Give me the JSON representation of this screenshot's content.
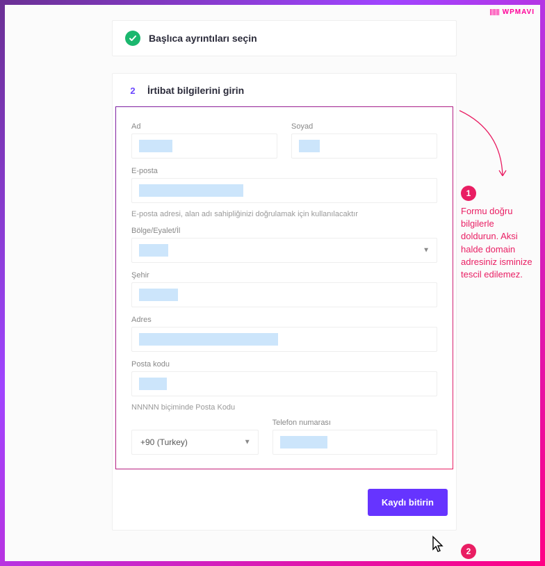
{
  "brand": "WPMAVI",
  "step1": {
    "title": "Başlıca ayrıntıları seçin"
  },
  "step2": {
    "number": "2",
    "title": "İrtibat bilgilerini girin"
  },
  "fields": {
    "first_name": "Ad",
    "last_name": "Soyad",
    "email": "E-posta",
    "email_hint": "E-posta adresi, alan adı sahipliğinizi doğrulamak için kullanılacaktır",
    "region": "Bölge/Eyalet/İl",
    "city": "Şehir",
    "address": "Adres",
    "postal": "Posta kodu",
    "postal_hint": "NNNNN biçiminde Posta Kodu",
    "phone": "Telefon numarası",
    "country_code": "+90 (Turkey)"
  },
  "submit_label": "Kaydı bitirin",
  "annotations": {
    "one": "1",
    "one_text": "Formu doğru bilgilerle doldurun. Aksi halde domain adresiniz isminize tescil edilemez.",
    "two": "2"
  }
}
